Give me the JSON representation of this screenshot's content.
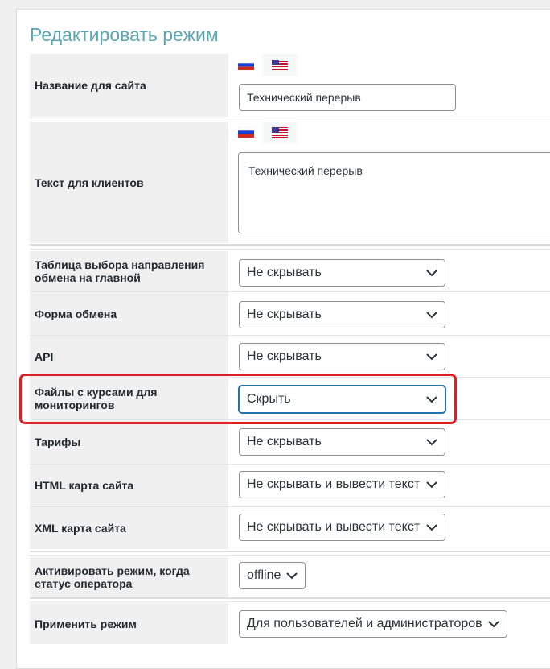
{
  "page": {
    "title": "Редактировать режим"
  },
  "languages": [
    {
      "code": "ru",
      "icon": "russia-flag-icon"
    },
    {
      "code": "en",
      "icon": "usa-flag-icon"
    }
  ],
  "fields": {
    "site_name": {
      "label": "Название для сайта",
      "value": "Технический перерыв"
    },
    "client_text": {
      "label": "Текст для клиентов",
      "value": "Технический перерыв"
    },
    "direction_table": {
      "label": "Таблица выбора направления обмена на главной",
      "value": "Не скрывать"
    },
    "exchange_form": {
      "label": "Форма обмена",
      "value": "Не скрывать"
    },
    "api": {
      "label": "API",
      "value": "Не скрывать"
    },
    "rates_files": {
      "label": "Файлы с курсами для мониторингов",
      "value": "Скрыть"
    },
    "tariffs": {
      "label": "Тарифы",
      "value": "Не скрывать"
    },
    "html_sitemap": {
      "label": "HTML карта сайта",
      "value": "Не скрывать и вывести текст"
    },
    "xml_sitemap": {
      "label": "XML карта сайта",
      "value": "Не скрывать и вывести текст"
    },
    "activate_when": {
      "label": "Активировать режим, когда статус оператора",
      "value": "offline"
    },
    "apply_mode": {
      "label": "Применить режим",
      "value": "Для пользователей и администраторов"
    }
  },
  "colors": {
    "title": "#5aa7b4",
    "highlight": "#e11d22",
    "focus": "#2271b1"
  }
}
